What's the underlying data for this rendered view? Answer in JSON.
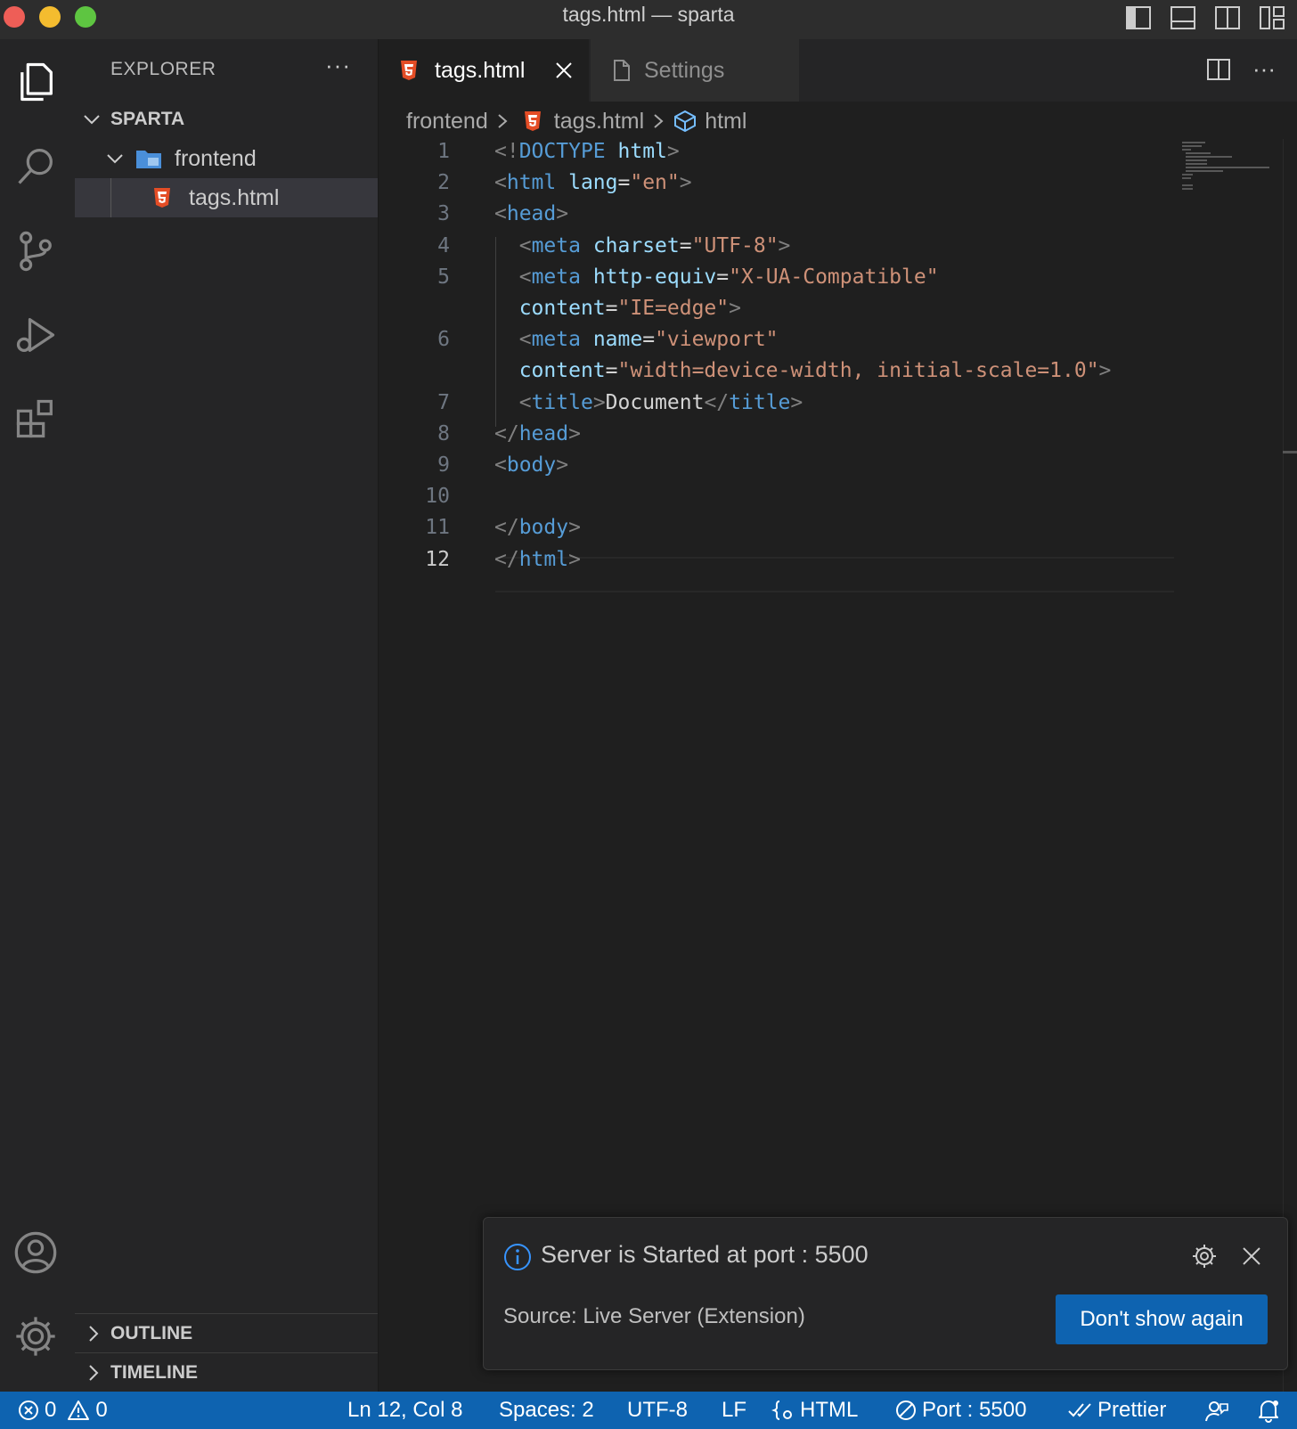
{
  "window": {
    "title": "tags.html — sparta"
  },
  "explorer": {
    "header": "EXPLORER",
    "more": "···",
    "workspace": "SPARTA",
    "folder": "frontend",
    "file": "tags.html",
    "sections": [
      "OUTLINE",
      "TIMELINE"
    ]
  },
  "tabs": [
    {
      "label": "tags.html",
      "active": true,
      "icon": "html5-icon"
    },
    {
      "label": "Settings",
      "active": false,
      "icon": "file-icon"
    }
  ],
  "breadcrumb": {
    "folder": "frontend",
    "file": "tags.html",
    "symbol": "html"
  },
  "editor": {
    "current_line": 12,
    "lines": [
      {
        "n": "1",
        "tokens": [
          [
            "p",
            "<!"
          ],
          [
            "t",
            "DOCTYPE"
          ],
          [
            "c",
            " "
          ],
          [
            "a",
            "html"
          ],
          [
            "p",
            ">"
          ]
        ]
      },
      {
        "n": "2",
        "tokens": [
          [
            "p",
            "<"
          ],
          [
            "t",
            "html"
          ],
          [
            "c",
            " "
          ],
          [
            "a",
            "lang"
          ],
          [
            "c",
            "="
          ],
          [
            "s",
            "\"en\""
          ],
          [
            "p",
            ">"
          ]
        ]
      },
      {
        "n": "3",
        "tokens": [
          [
            "p",
            "<"
          ],
          [
            "t",
            "head"
          ],
          [
            "p",
            ">"
          ]
        ]
      },
      {
        "n": "4",
        "tokens": [
          [
            "c",
            "  "
          ],
          [
            "p",
            "<"
          ],
          [
            "t",
            "meta"
          ],
          [
            "c",
            " "
          ],
          [
            "a",
            "charset"
          ],
          [
            "c",
            "="
          ],
          [
            "s",
            "\"UTF-8\""
          ],
          [
            "p",
            ">"
          ]
        ]
      },
      {
        "n": "5",
        "tokens": [
          [
            "c",
            "  "
          ],
          [
            "p",
            "<"
          ],
          [
            "t",
            "meta"
          ],
          [
            "c",
            " "
          ],
          [
            "a",
            "http-equiv"
          ],
          [
            "c",
            "="
          ],
          [
            "s",
            "\"X-UA-Compatible\""
          ]
        ]
      },
      {
        "n": "",
        "tokens": [
          [
            "c",
            "  "
          ],
          [
            "a",
            "content"
          ],
          [
            "c",
            "="
          ],
          [
            "s",
            "\"IE=edge\""
          ],
          [
            "p",
            ">"
          ]
        ]
      },
      {
        "n": "6",
        "tokens": [
          [
            "c",
            "  "
          ],
          [
            "p",
            "<"
          ],
          [
            "t",
            "meta"
          ],
          [
            "c",
            " "
          ],
          [
            "a",
            "name"
          ],
          [
            "c",
            "="
          ],
          [
            "s",
            "\"viewport\""
          ]
        ]
      },
      {
        "n": "",
        "tokens": [
          [
            "c",
            "  "
          ],
          [
            "a",
            "content"
          ],
          [
            "c",
            "="
          ],
          [
            "s",
            "\"width=device-width, initial-scale=1.0\""
          ],
          [
            "p",
            ">"
          ]
        ]
      },
      {
        "n": "7",
        "tokens": [
          [
            "c",
            "  "
          ],
          [
            "p",
            "<"
          ],
          [
            "t",
            "title"
          ],
          [
            "p",
            ">"
          ],
          [
            "c",
            "Document"
          ],
          [
            "p",
            "</"
          ],
          [
            "t",
            "title"
          ],
          [
            "p",
            ">"
          ]
        ]
      },
      {
        "n": "8",
        "tokens": [
          [
            "p",
            "</"
          ],
          [
            "t",
            "head"
          ],
          [
            "p",
            ">"
          ]
        ]
      },
      {
        "n": "9",
        "tokens": [
          [
            "p",
            "<"
          ],
          [
            "t",
            "body"
          ],
          [
            "p",
            ">"
          ]
        ]
      },
      {
        "n": "10",
        "tokens": []
      },
      {
        "n": "11",
        "tokens": [
          [
            "p",
            "</"
          ],
          [
            "t",
            "body"
          ],
          [
            "p",
            ">"
          ]
        ]
      },
      {
        "n": "12",
        "tokens": [
          [
            "p",
            "</"
          ],
          [
            "t",
            "html"
          ],
          [
            "p",
            ">"
          ]
        ]
      }
    ]
  },
  "notification": {
    "message": "Server is Started at port : 5500",
    "source": "Source: Live Server (Extension)",
    "button": "Don't show again"
  },
  "status": {
    "errors": "0",
    "warnings": "0",
    "position": "Ln 12, Col 8",
    "spaces": "Spaces: 2",
    "encoding": "UTF-8",
    "eol": "LF",
    "language": "HTML",
    "port": "Port : 5500",
    "formatter": "Prettier"
  },
  "colors": {
    "accent": "#0e63b0",
    "tag": "#569cd6",
    "attribute": "#9cdcfe",
    "string": "#ce9178",
    "html_icon": "#e44d26"
  }
}
